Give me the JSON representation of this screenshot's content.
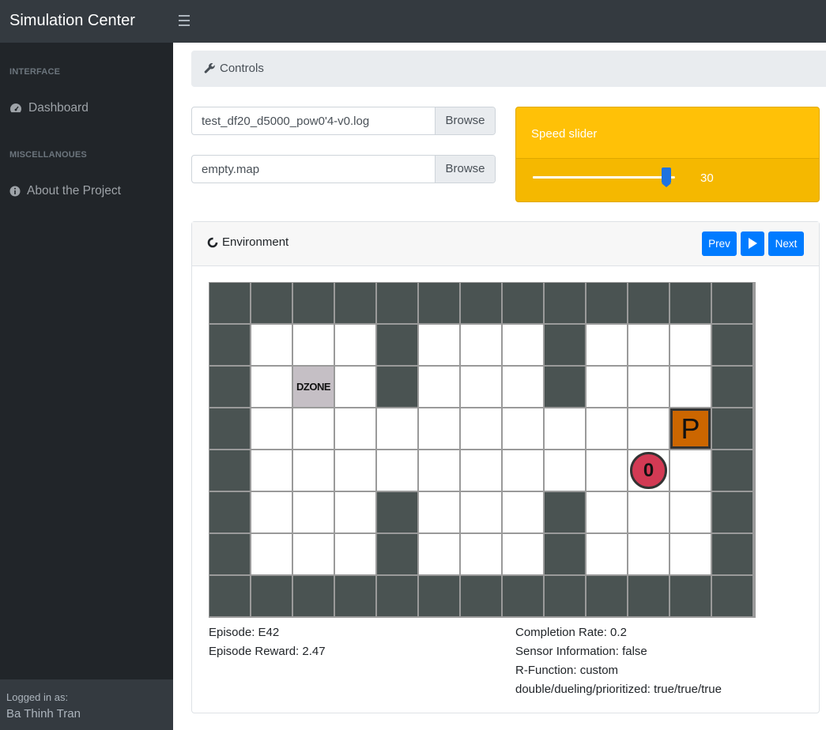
{
  "app": {
    "title": "Simulation Center",
    "menu_icon": "hamburger-icon"
  },
  "sidebar": {
    "sections": [
      {
        "heading": "INTERFACE",
        "items": [
          {
            "label": "Dashboard",
            "icon": "tachometer-icon"
          }
        ]
      },
      {
        "heading": "MISCELLANOUES",
        "items": [
          {
            "label": "About the Project",
            "icon": "info-circle-icon"
          }
        ]
      }
    ],
    "footer": {
      "label": "Logged in as:",
      "user": "Ba Thinh Tran"
    }
  },
  "controls": {
    "header": "Controls",
    "header_icon": "wrench-icon",
    "log_file": {
      "value": "test_df20_d5000_pow0'4-v0.log",
      "button": "Browse"
    },
    "map_file": {
      "value": "empty.map",
      "button": "Browse"
    }
  },
  "speed": {
    "title": "Speed slider",
    "value": 30,
    "min": 0,
    "max": 30,
    "fill_fraction": 0.94
  },
  "environment": {
    "title": "Environment",
    "title_icon": "spinner-icon",
    "buttons": {
      "prev": "Prev",
      "play_icon": "play-icon",
      "next": "Next"
    },
    "grid": {
      "rows": [
        "#############",
        "#...#...#...#",
        "#.D.#...#...#",
        "#..........P#",
        "#..........A#",
        "#...#...#...#",
        "#...#...#...#",
        "#############"
      ],
      "agent": {
        "label": "0",
        "row": 4,
        "col": 10
      },
      "dzone_label": "DZONE",
      "pickup_label": "P"
    },
    "stats_left": [
      "Episode: E42",
      "Episode Reward: 2.47"
    ],
    "stats_right": [
      "Completion Rate: 0.2",
      "Sensor Information: false",
      "R-Function: custom",
      "double/dueling/prioritized: true/true/true"
    ]
  },
  "colors": {
    "navbar": "#343a40",
    "sidebar": "#212529",
    "speed_card": "#ffc107",
    "button": "#007bff",
    "wall": "#4a5352",
    "pickup": "#cc6600",
    "agent": "#d23a54",
    "dzone": "#c5bfc5"
  }
}
